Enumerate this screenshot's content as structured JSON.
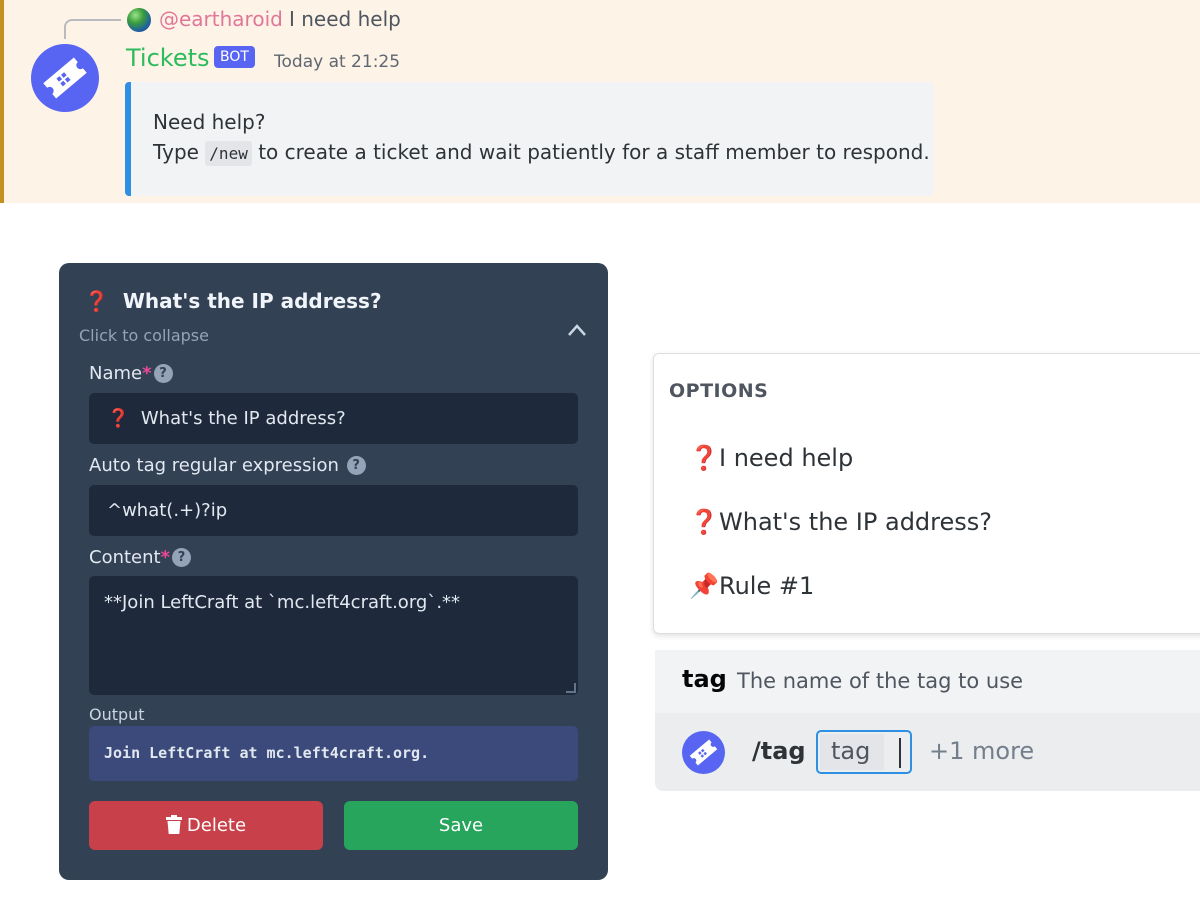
{
  "message": {
    "reply": {
      "username": "@eartharoid",
      "text": "I need help"
    },
    "author": "Tickets",
    "badge": "BOT",
    "timestamp": "Today at 21:25",
    "embed": {
      "title": "Need help?",
      "line_prefix": "Type",
      "code": "/new",
      "line_suffix": "to create a ticket and wait patiently for a staff member to respond."
    },
    "colors": {
      "author": "#2dbb5d",
      "reply_user": "#e0779a",
      "embed_accent": "#2f8fe3",
      "badge": "#5865f2"
    }
  },
  "editor": {
    "title_icon": "❓",
    "title": "What's the IP address?",
    "collapse_text": "Click to collapse",
    "name_label": "Name",
    "name_value": "What's the IP address?",
    "name_icon": "❓",
    "regex_label": "Auto tag regular expression",
    "regex_value": "^what(.+)?ip",
    "content_label": "Content",
    "content_value": "**Join LeftCraft at `mc.left4craft.org`.**",
    "required_mark": "*",
    "help_mark": "?",
    "output_label": "Output",
    "output_value": "Join LeftCraft at mc.left4craft.org.",
    "delete_label": "Delete",
    "save_label": "Save",
    "colors": {
      "panel": "#334155",
      "delete": "#c8414a",
      "save": "#27a55d"
    }
  },
  "options": {
    "heading": "OPTIONS",
    "items": [
      {
        "icon": "❓",
        "label": "I need help"
      },
      {
        "icon": "❓",
        "label": "What's the IP address?"
      },
      {
        "icon": "📌",
        "label": "Rule #1"
      }
    ]
  },
  "command": {
    "param_name": "tag",
    "param_desc": "The name of the tag to use",
    "slash": "/tag",
    "input_value": "tag",
    "more": "+1 more"
  }
}
